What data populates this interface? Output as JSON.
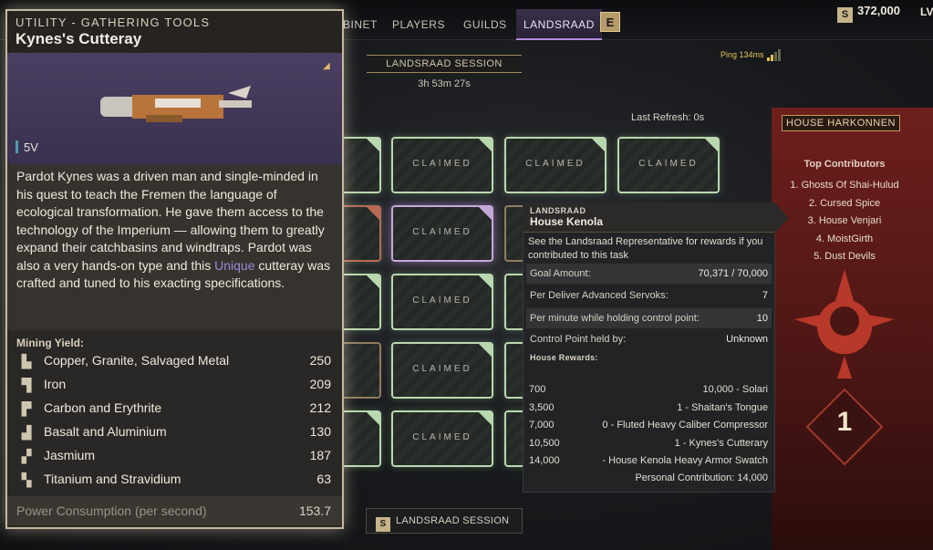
{
  "nav": {
    "tabs": [
      {
        "label": "BINET"
      },
      {
        "label": "PLAYERS"
      },
      {
        "label": "GUILDS"
      },
      {
        "label": "LANDSRAAD"
      }
    ],
    "e_key": "E",
    "currency_icon_label": "S",
    "currency_amount": "372,000",
    "level_label": "LV"
  },
  "landsraad": {
    "session_label": "LANDSRAAD SESSION",
    "session_timer": "3h 53m 27s",
    "ping": "Ping 134ms",
    "last_refresh": "Last Refresh:  0s",
    "tile_claimed_label": "CLAIMED",
    "session_button_key": "S",
    "session_button_label": "LANDSRAAD SESSION"
  },
  "house_panel": {
    "house_name": "HOUSE HARKONNEN",
    "contributors_title": "Top Contributors",
    "contributors": [
      "1. Ghosts Of Shai-Hulud",
      "2. Cursed Spice",
      "3. House Venjari",
      "4. MoistGirth",
      "5. Dust Devils"
    ],
    "rank": "1",
    "accent_color": "#6e1f1c"
  },
  "task_tooltip": {
    "subtitle": "LANDSRAAD",
    "title": "House Kenola",
    "description": "See the Landsraad Representative for rewards if you contributed to this task",
    "rows": [
      {
        "label": "Goal Amount:",
        "value": "70,371 / 70,000"
      },
      {
        "label": "Per Deliver Advanced Servoks:",
        "value": "7"
      },
      {
        "label": "Per minute while holding control point:",
        "value": "10"
      },
      {
        "label": "Control Point held by:",
        "value": "Unknown"
      }
    ],
    "rewards_title": "House Rewards:",
    "rewards": [
      {
        "threshold": "700",
        "reward": "10,000 - Solari"
      },
      {
        "threshold": "3,500",
        "reward": "1 - Shaitan's Tongue"
      },
      {
        "threshold": "7,000",
        "reward": "0 - Fluted Heavy Caliber Compressor"
      },
      {
        "threshold": "10,500",
        "reward": "1 - Kynes's Cutterary"
      },
      {
        "threshold": "14,000",
        "reward": "- House Kenola Heavy Armor Swatch"
      }
    ],
    "personal_contribution": "Personal Contribution: 14,000"
  },
  "item_tooltip": {
    "category": "UTILITY - GATHERING TOOLS",
    "name": "Kynes's Cutteray",
    "volume": "5V",
    "lore_before": "Pardot Kynes was a driven man and single-minded in his quest to teach the Fremen the language of ecological transformation. He gave them access to the technology of the Imperium — allowing them to greatly expand their catchbasins and windtraps. Pardot was also a very hands-on type and this ",
    "lore_unique": "Unique",
    "lore_after": " cutteray was crafted and tuned to his exacting specifications.",
    "unique_color": "#9e86d8",
    "yield_title": "Mining Yield:",
    "yields": [
      {
        "name": "Copper, Granite, Salvaged Metal",
        "value": "250",
        "icon": "ore-icon"
      },
      {
        "name": "Iron",
        "value": "209",
        "icon": "ore-icon"
      },
      {
        "name": "Carbon and Erythrite",
        "value": "212",
        "icon": "ore-icon"
      },
      {
        "name": "Basalt and Aluminium",
        "value": "130",
        "icon": "ore-icon"
      },
      {
        "name": "Jasmium",
        "value": "187",
        "icon": "ore-icon"
      },
      {
        "name": "Titanium and Stravidium",
        "value": "63",
        "icon": "ore-icon"
      }
    ],
    "power_label": "Power Consumption (per second)",
    "power_value": "153.7"
  }
}
